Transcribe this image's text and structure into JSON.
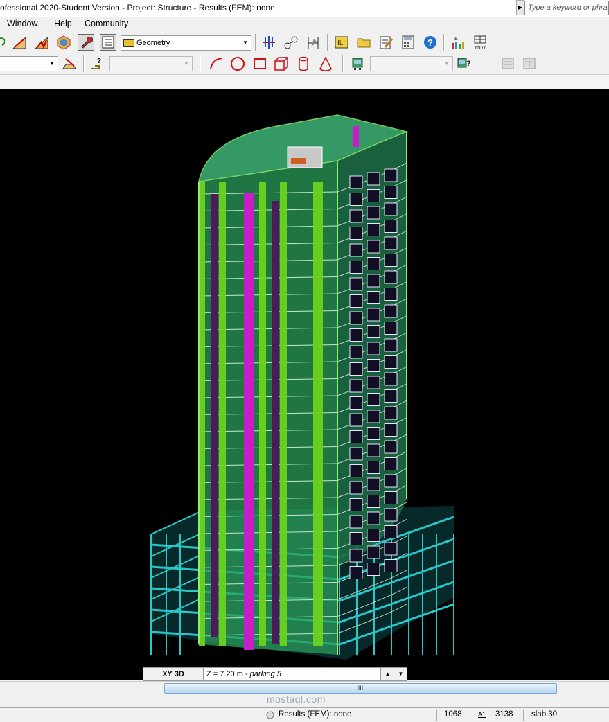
{
  "window": {
    "title": "ofessional 2020-Student Version - Project: Structure - Results (FEM): none",
    "search_placeholder": "Type a keyword or phrase"
  },
  "menu": [
    "Window",
    "Help",
    "Community"
  ],
  "toolbar": {
    "layout_combo": "Geometry",
    "icons_row1": [
      "section-icon",
      "frame-icon",
      "truss-icon",
      "model-3d-icon",
      "wrench-icon",
      "table-view-icon",
      "node-numbering-icon",
      "node-labels-icon",
      "dimension-icon",
      "tag-icon",
      "open-folder-icon",
      "edit-notes-icon",
      "calculator-icon",
      "help-icon",
      "result-bars-icon",
      "result-grid-icon"
    ],
    "icons_row2": [
      "slab-support-icon",
      "query-icon",
      "arc-icon",
      "circle-icon",
      "rectangle-icon",
      "box-icon",
      "cylinder-icon",
      "cone-icon",
      "display-icon",
      "display-help-icon",
      "disabled-screen-icon",
      "disabled-screen-2-icon"
    ],
    "colors": {
      "shape_red": "#cc1111",
      "help_blue": "#1e6fd0"
    }
  },
  "model_colors": {
    "background": "#000000",
    "tower_panels": "#2a9e5a",
    "edges": "#8cf06e",
    "columns": "#6cd21e",
    "core_purple": "#c81ec8",
    "podium_cyan": "#28c8c8"
  },
  "viewbar": {
    "view": "XY 3D",
    "level_prefix": "Z = 7.20 m - ",
    "level_name": "parking 5"
  },
  "scroll": {
    "thumb_label": "III"
  },
  "watermark": "mostaql.com",
  "status": {
    "results": "Results (FEM): none",
    "value1": "1068",
    "value2": "3138",
    "slab": "slab 30"
  }
}
